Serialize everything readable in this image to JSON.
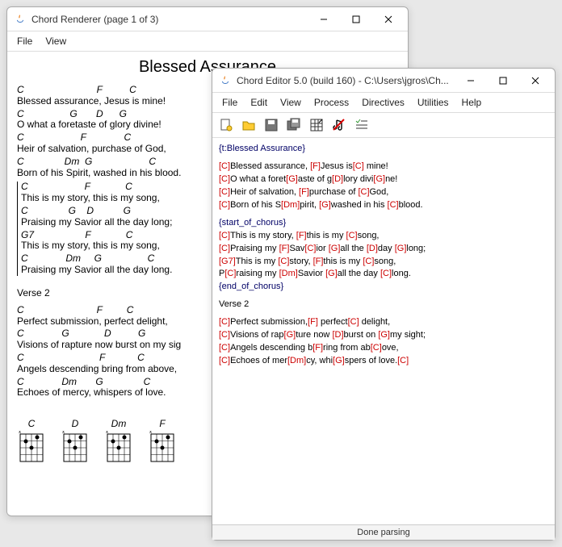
{
  "renderer": {
    "title": "Chord Renderer (page 1 of 3)",
    "menus": [
      "File",
      "View"
    ],
    "songTitle": "Blessed Assurance",
    "verse1": [
      {
        "chords": "C                           F          C",
        "lyrics": "Blessed assurance, Jesus is mine!"
      },
      {
        "chords": "C                 G       D      G",
        "lyrics": "O what a foretaste of glory divine!"
      },
      {
        "chords": "C                     F              C",
        "lyrics": "Heir of salvation, purchase of God,"
      },
      {
        "chords": "C               Dm  G                     C",
        "lyrics": "Born of his Spirit, washed in his blood."
      }
    ],
    "chorus": [
      {
        "chords": "C                     F             C",
        "lyrics": "This is my story, this is my song,"
      },
      {
        "chords": "C               G    D           G",
        "lyrics": "Praising my Savior all the day long;"
      },
      {
        "chords": "G7                   F             C",
        "lyrics": "This is my story, this is my song,"
      },
      {
        "chords": "C              Dm     G                 C",
        "lyrics": "Praising my Savior all the day long."
      }
    ],
    "verseLabel": "Verse 2",
    "verse2": [
      {
        "chords": "C                           F         C",
        "lyrics": "Perfect submission, perfect delight,"
      },
      {
        "chords": "C              G             D          G",
        "lyrics": "Visions of rapture now burst on my sig"
      },
      {
        "chords": "C                            F            C",
        "lyrics": "Angels descending bring from above,"
      },
      {
        "chords": "C              Dm       G               C",
        "lyrics": "Echoes of mercy, whispers of love."
      }
    ],
    "diagrams": [
      "C",
      "D",
      "Dm",
      "F"
    ]
  },
  "editor": {
    "title": "Chord Editor 5.0 (build 160) - C:\\Users\\jgros\\Ch...",
    "menus": [
      "File",
      "Edit",
      "View",
      "Process",
      "Directives",
      "Utilities",
      "Help"
    ],
    "lines": [
      {
        "t": "dir",
        "v": "{t:Blessed Assurance}"
      },
      {
        "t": "sep"
      },
      {
        "t": "mix",
        "p": [
          [
            "c",
            "[C]"
          ],
          [
            "l",
            "Blessed assurance, "
          ],
          [
            "c",
            "[F]"
          ],
          [
            "l",
            "Jesus is"
          ],
          [
            "c",
            "[C]"
          ],
          [
            "l",
            " mine!"
          ]
        ]
      },
      {
        "t": "mix",
        "p": [
          [
            "c",
            "[C]"
          ],
          [
            "l",
            "O what a foret"
          ],
          [
            "c",
            "[G]"
          ],
          [
            "l",
            "aste of g"
          ],
          [
            "c",
            "[D]"
          ],
          [
            "l",
            "lory divi"
          ],
          [
            "c",
            "[G]"
          ],
          [
            "l",
            "ne!"
          ]
        ]
      },
      {
        "t": "mix",
        "p": [
          [
            "c",
            "[C]"
          ],
          [
            "l",
            "Heir of salvation, "
          ],
          [
            "c",
            "[F]"
          ],
          [
            "l",
            "purchase of "
          ],
          [
            "c",
            "[C]"
          ],
          [
            "l",
            "God,"
          ]
        ]
      },
      {
        "t": "mix",
        "p": [
          [
            "c",
            "[C]"
          ],
          [
            "l",
            "Born of his S"
          ],
          [
            "c",
            "[Dm]"
          ],
          [
            "l",
            "pirit, "
          ],
          [
            "c",
            "[G]"
          ],
          [
            "l",
            "washed in his "
          ],
          [
            "c",
            "[C]"
          ],
          [
            "l",
            "blood."
          ]
        ]
      },
      {
        "t": "sep"
      },
      {
        "t": "dir",
        "v": "{start_of_chorus}"
      },
      {
        "t": "mix",
        "p": [
          [
            "c",
            "[C]"
          ],
          [
            "l",
            "This is my story, "
          ],
          [
            "c",
            "[F]"
          ],
          [
            "l",
            "this is my "
          ],
          [
            "c",
            "[C]"
          ],
          [
            "l",
            "song,"
          ]
        ]
      },
      {
        "t": "mix",
        "p": [
          [
            "c",
            "[C]"
          ],
          [
            "l",
            "Praising my "
          ],
          [
            "c",
            "[F]"
          ],
          [
            "l",
            "Sav"
          ],
          [
            "c",
            "[C]"
          ],
          [
            "l",
            "ior "
          ],
          [
            "c",
            "[G]"
          ],
          [
            "l",
            "all the "
          ],
          [
            "c",
            "[D]"
          ],
          [
            "l",
            "day "
          ],
          [
            "c",
            "[G]"
          ],
          [
            "l",
            "long;"
          ]
        ]
      },
      {
        "t": "mix",
        "p": [
          [
            "c",
            "[G7]"
          ],
          [
            "l",
            "This is my "
          ],
          [
            "c",
            "[C]"
          ],
          [
            "l",
            "story, "
          ],
          [
            "c",
            "[F]"
          ],
          [
            "l",
            "this is my "
          ],
          [
            "c",
            "[C]"
          ],
          [
            "l",
            "song,"
          ]
        ]
      },
      {
        "t": "mix",
        "p": [
          [
            "l",
            "P"
          ],
          [
            "c",
            "[C]"
          ],
          [
            "l",
            "raising my "
          ],
          [
            "c",
            "[Dm]"
          ],
          [
            "l",
            "Savior "
          ],
          [
            "c",
            "[G]"
          ],
          [
            "l",
            "all the day "
          ],
          [
            "c",
            "[C]"
          ],
          [
            "l",
            "long."
          ]
        ]
      },
      {
        "t": "dir",
        "v": "{end_of_chorus}"
      },
      {
        "t": "sep"
      },
      {
        "t": "plain",
        "v": "Verse 2"
      },
      {
        "t": "sep"
      },
      {
        "t": "mix",
        "p": [
          [
            "c",
            "[C]"
          ],
          [
            "l",
            "Perfect submission,"
          ],
          [
            "c",
            "[F]"
          ],
          [
            "l",
            " perfect"
          ],
          [
            "c",
            "[C]"
          ],
          [
            "l",
            " delight,"
          ]
        ]
      },
      {
        "t": "mix",
        "p": [
          [
            "c",
            "[C]"
          ],
          [
            "l",
            "Visions of rap"
          ],
          [
            "c",
            "[G]"
          ],
          [
            "l",
            "ture now "
          ],
          [
            "c",
            "[D]"
          ],
          [
            "l",
            "burst on "
          ],
          [
            "c",
            "[G]"
          ],
          [
            "l",
            "my sight;"
          ]
        ]
      },
      {
        "t": "mix",
        "p": [
          [
            "c",
            "[C]"
          ],
          [
            "l",
            "Angels descending b"
          ],
          [
            "c",
            "[F]"
          ],
          [
            "l",
            "ring from ab"
          ],
          [
            "c",
            "[C]"
          ],
          [
            "l",
            "ove,"
          ]
        ]
      },
      {
        "t": "mix",
        "p": [
          [
            "c",
            "[C]"
          ],
          [
            "l",
            "Echoes of mer"
          ],
          [
            "c",
            "[Dm]"
          ],
          [
            "l",
            "cy, whi"
          ],
          [
            "c",
            "[G]"
          ],
          [
            "l",
            "spers of love."
          ],
          [
            "c",
            "[C]"
          ]
        ]
      }
    ],
    "status": "Done parsing"
  }
}
